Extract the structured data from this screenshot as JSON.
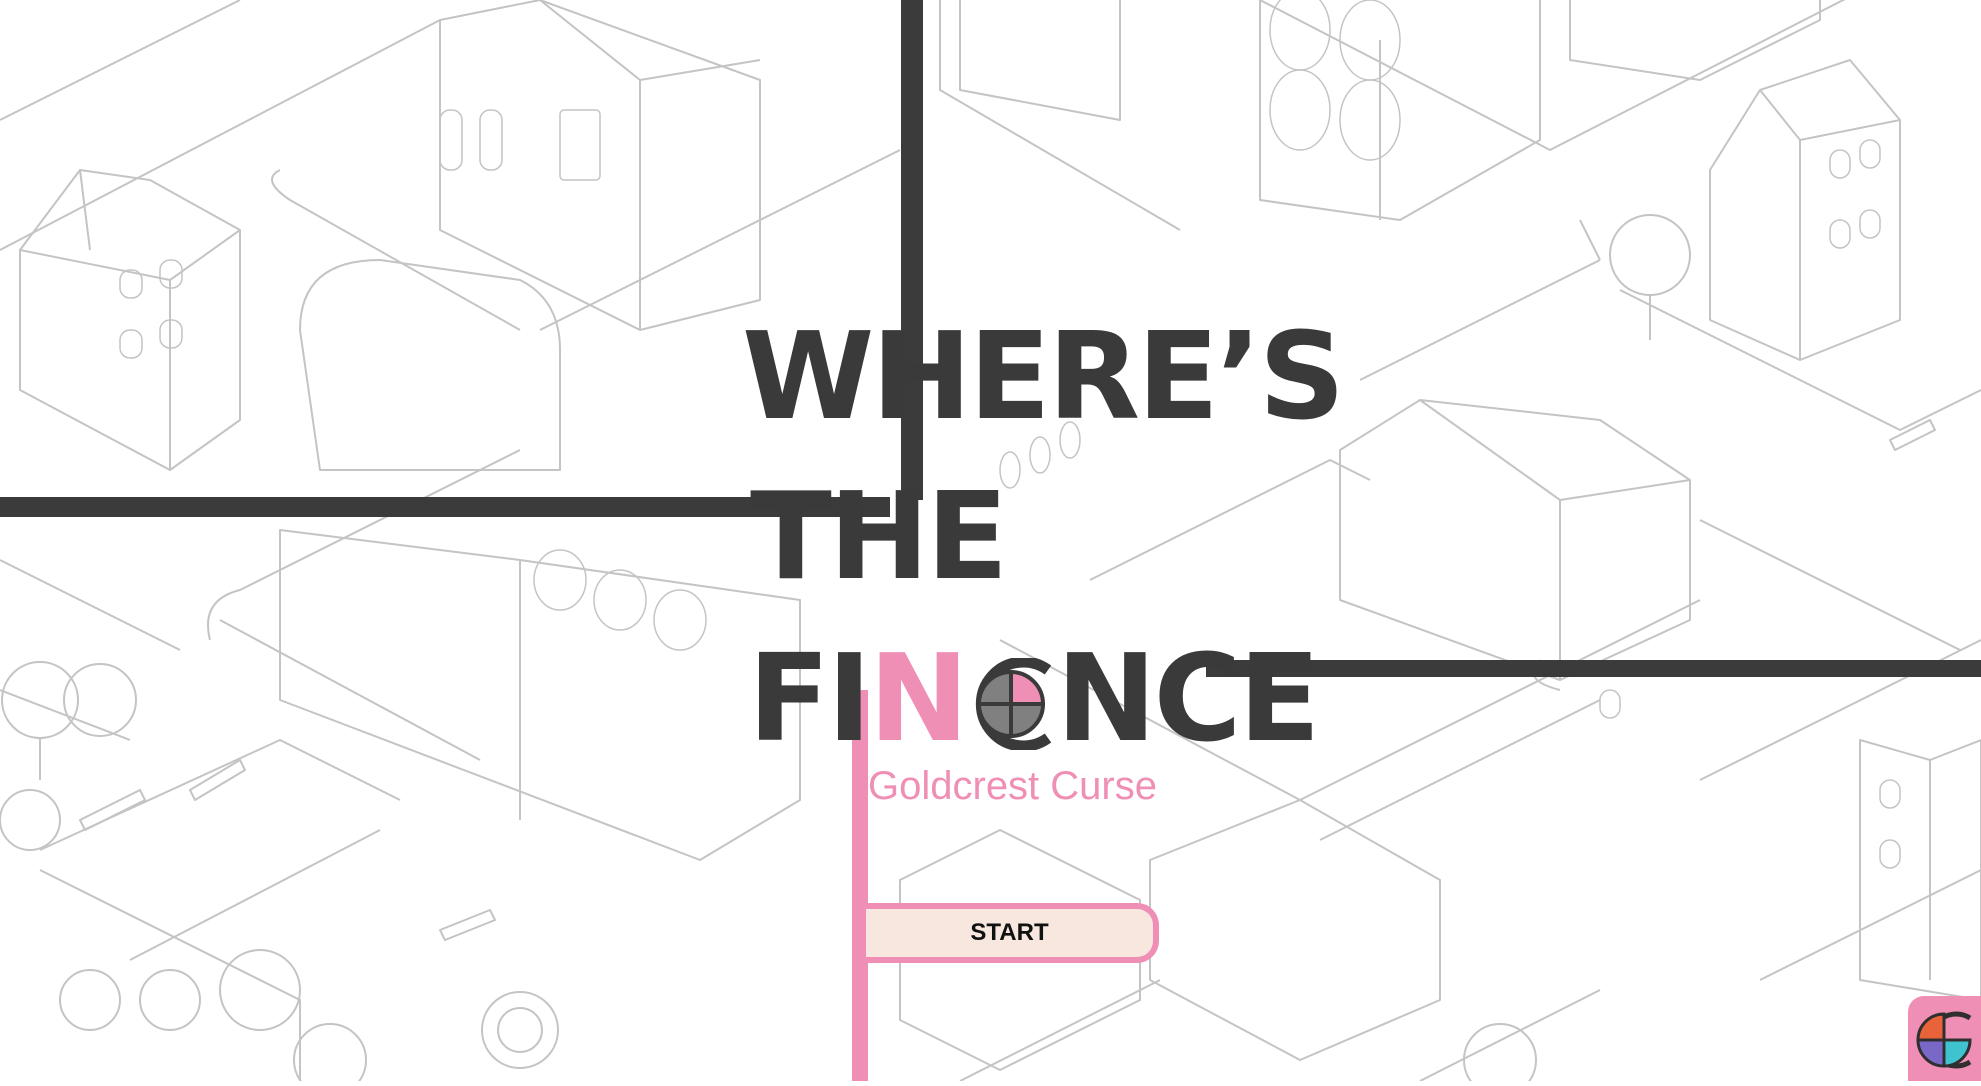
{
  "title": {
    "line1": "WHERE’S",
    "line2": "THE",
    "line3_start": "FI",
    "line3_n": "N",
    "line3_end": "NCE"
  },
  "subtitle": "Goldcrest Curse",
  "start_button": {
    "label": "START"
  },
  "logo": {
    "icon": "app-logo-icon"
  },
  "colors": {
    "accent_pink": "#ef8fb5",
    "title_dark": "#3a3a3a",
    "button_fill": "#f7e7de",
    "map_line": "#bdbdbd",
    "logo_orange": "#e8623a",
    "logo_purple": "#7a68c8",
    "logo_teal": "#3fc3cf"
  }
}
